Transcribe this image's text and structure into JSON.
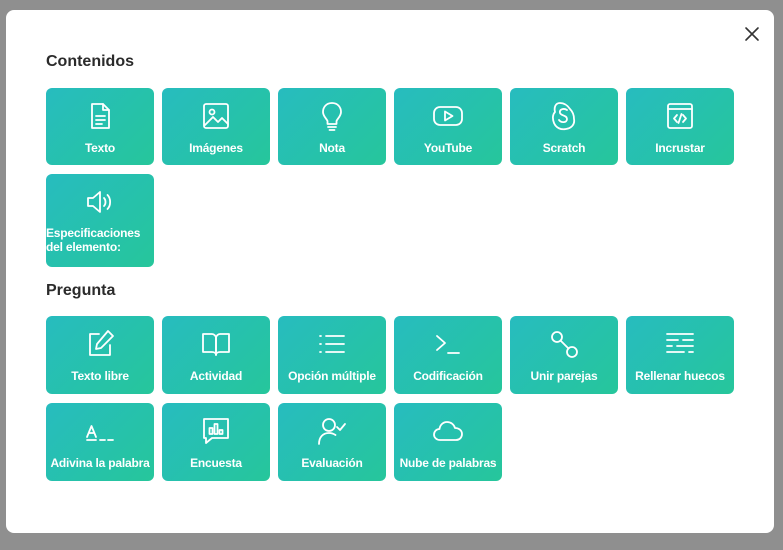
{
  "modal": {
    "close_icon": "close-icon"
  },
  "contenidos": {
    "title": "Contenidos",
    "items": [
      {
        "label": "Texto",
        "icon": "document-icon"
      },
      {
        "label": "Imágenes",
        "icon": "image-icon"
      },
      {
        "label": "Nota",
        "icon": "lightbulb-icon"
      },
      {
        "label": "YouTube",
        "icon": "youtube-icon"
      },
      {
        "label": "Scratch",
        "icon": "scratch-icon"
      },
      {
        "label": "Incrustar",
        "icon": "embed-code-icon"
      },
      {
        "label": "Especificaciones del elemento:",
        "icon": "speaker-icon"
      }
    ]
  },
  "pregunta": {
    "title": "Pregunta",
    "items": [
      {
        "label": "Texto libre",
        "icon": "edit-icon"
      },
      {
        "label": "Actividad",
        "icon": "book-icon"
      },
      {
        "label": "Opción múltiple",
        "icon": "list-icon"
      },
      {
        "label": "Codificación",
        "icon": "terminal-icon"
      },
      {
        "label": "Unir parejas",
        "icon": "connect-icon"
      },
      {
        "label": "Rellenar huecos",
        "icon": "fill-gaps-icon"
      },
      {
        "label": "Adivina la palabra",
        "icon": "guess-word-icon"
      },
      {
        "label": "Encuesta",
        "icon": "poll-icon"
      },
      {
        "label": "Evaluación",
        "icon": "user-check-icon"
      },
      {
        "label": "Nube de palabras",
        "icon": "cloud-icon"
      }
    ]
  },
  "colors": {
    "tile_gradient_start": "#27bcbf",
    "tile_gradient_end": "#26c69b",
    "overlay": "#8f8f8f"
  }
}
